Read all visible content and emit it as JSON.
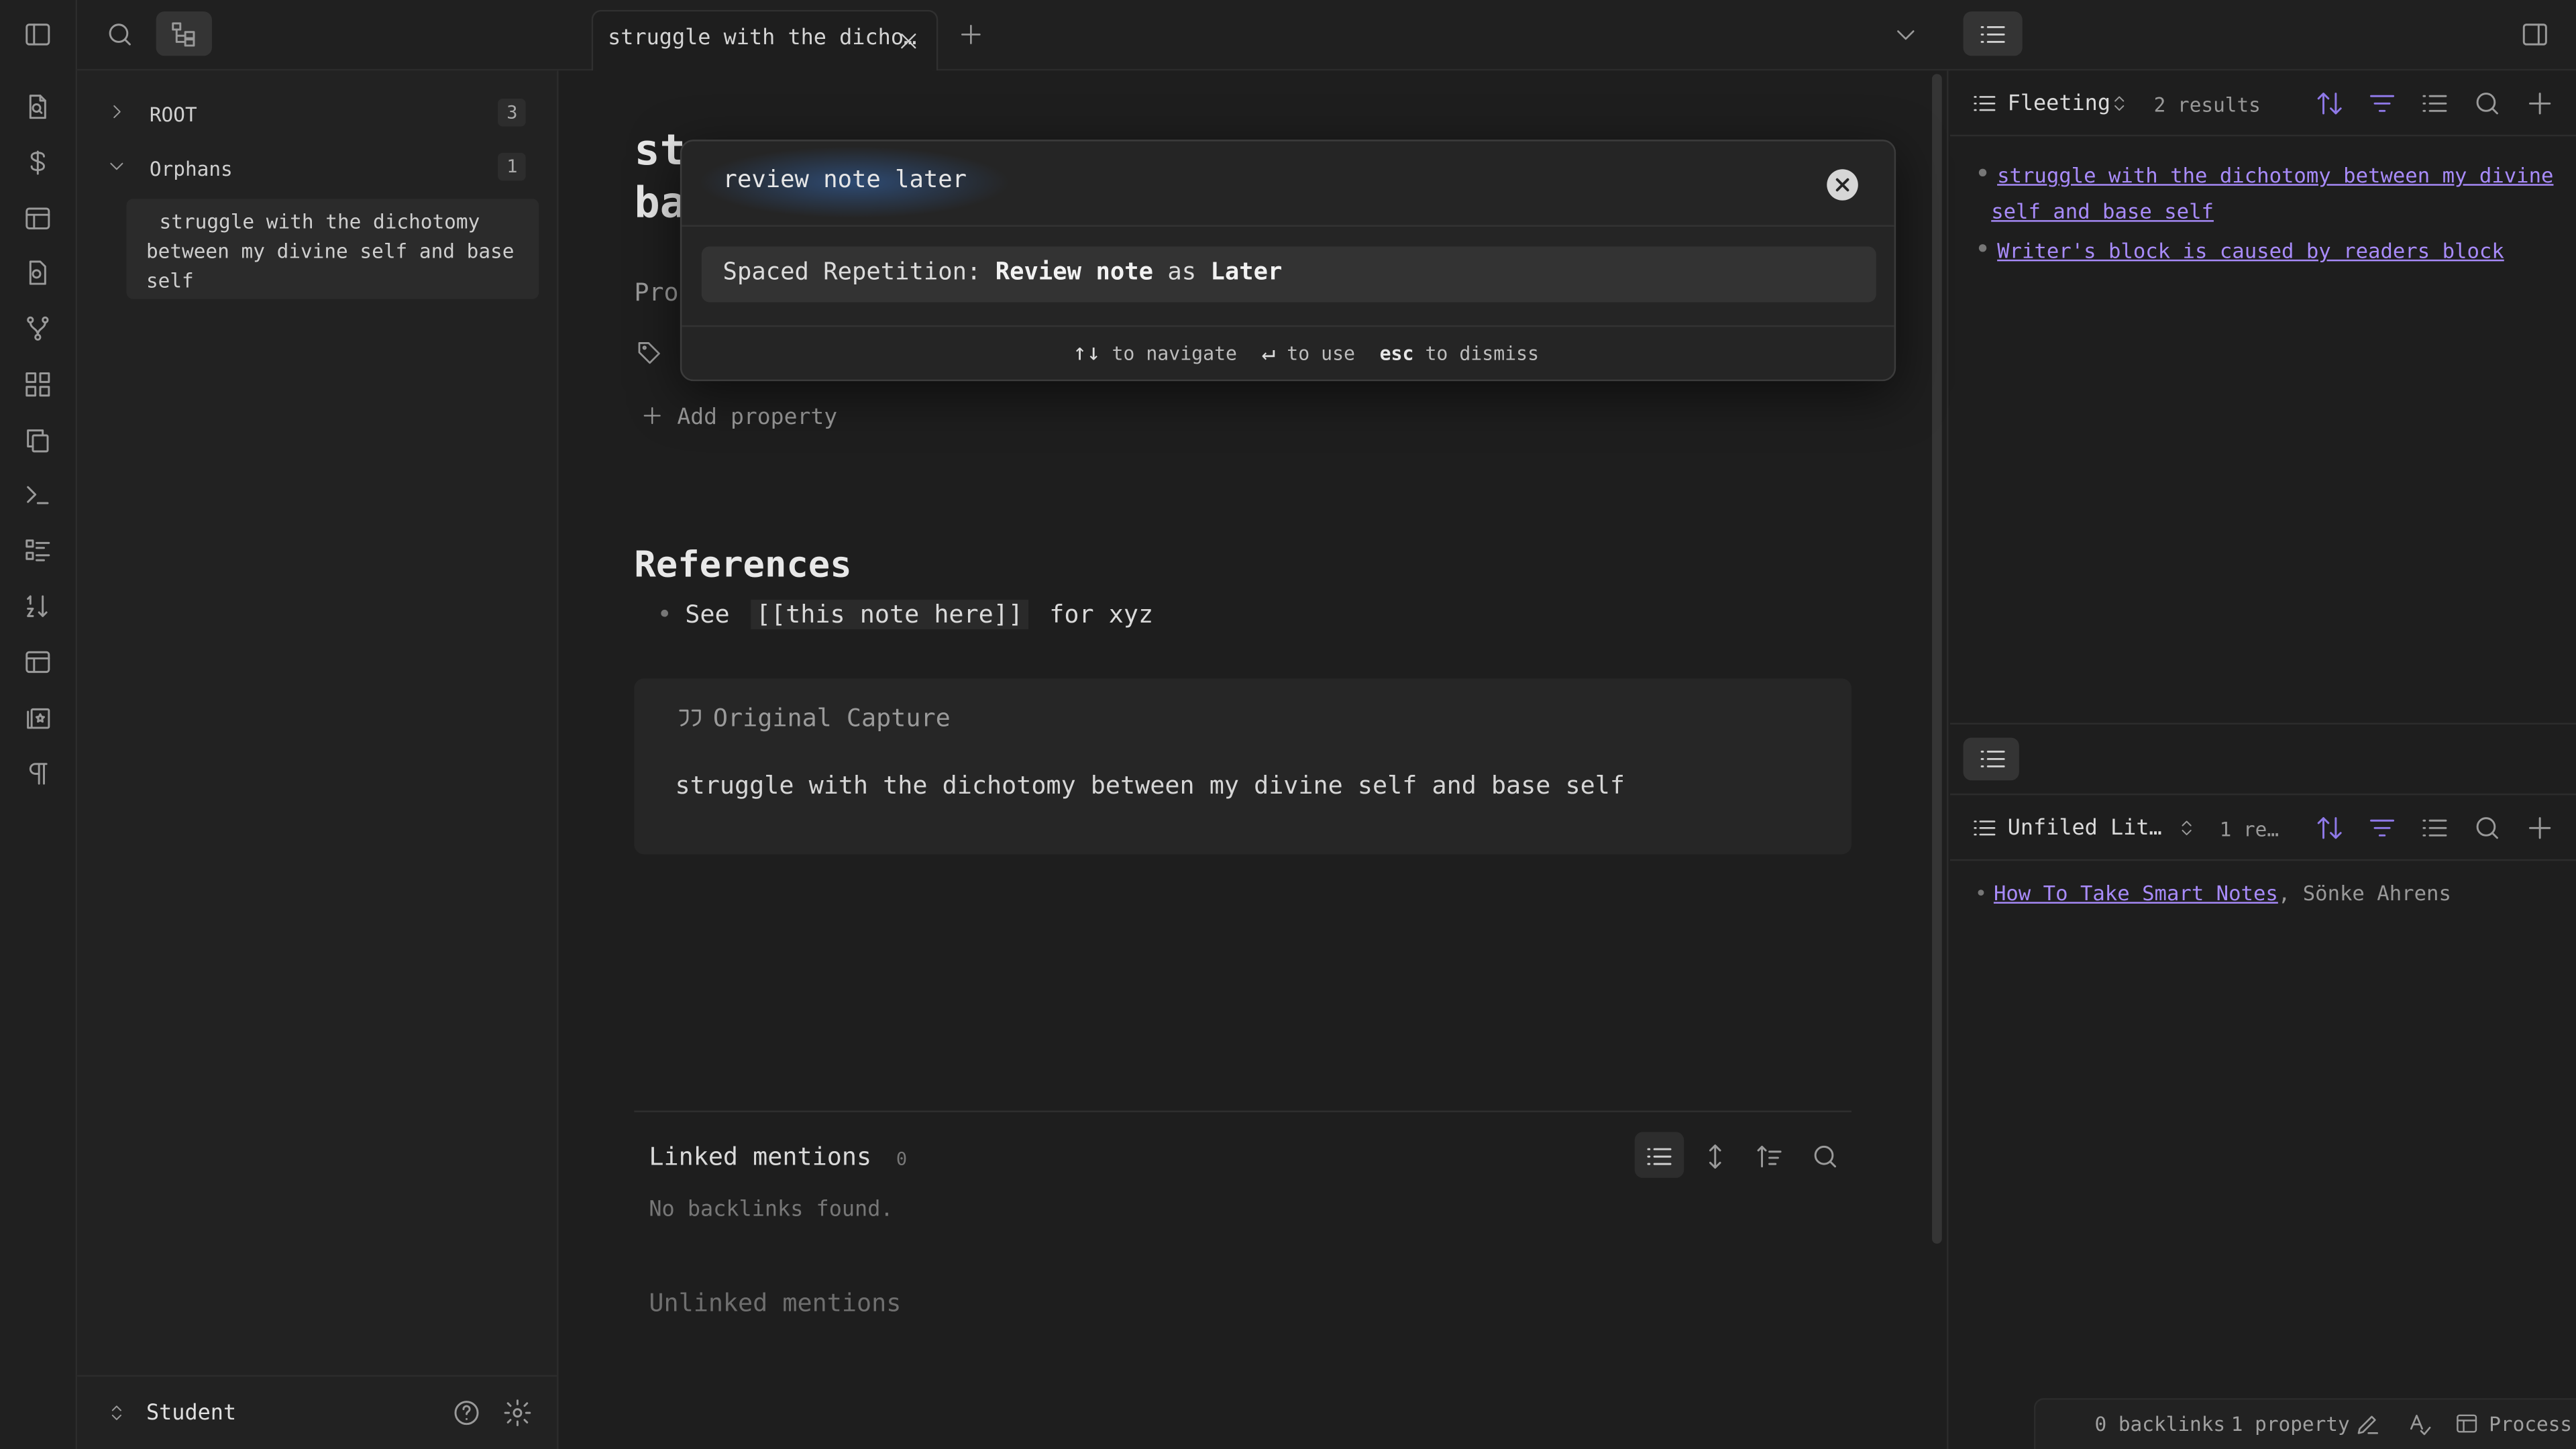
{
  "tab": {
    "title": "struggle with the dicho…"
  },
  "explorer": {
    "root_label": "ROOT",
    "root_count": "3",
    "orphans_label": "Orphans",
    "orphans_count": "1",
    "note_card": "struggle with the dichotomy between my divine self and base self",
    "vault_name": "Student"
  },
  "editor": {
    "title_line1": "st",
    "title_line2": "ba",
    "properties_label": "Pro",
    "add_property": "Add property",
    "references_heading": "References",
    "ref_see": "See",
    "ref_link": "[[this note here]]",
    "ref_rest": "for xyz",
    "callout_title": "Original Capture",
    "callout_body": "struggle with the dichotomy between my divine self and base self",
    "linked_mentions": "Linked mentions",
    "linked_count": "0",
    "no_backlinks": "No backlinks found.",
    "unlinked_mentions": "Unlinked mentions"
  },
  "popup": {
    "query": "review note later",
    "suggestion_prefix": "Spaced Repetition:",
    "suggestion_bold1": "Review note",
    "suggestion_mid": "as",
    "suggestion_bold2": "Later",
    "hint_navigate": "to navigate",
    "hint_use": "to use",
    "hint_esc": "esc",
    "hint_dismiss": "to dismiss"
  },
  "right_top": {
    "query_name": "Fleeting",
    "results": "2 results",
    "items": [
      "struggle with the dichotomy between my divine",
      "self and base self",
      "Writer's block is caused by readers block"
    ]
  },
  "right_bottom": {
    "query_name": "Unfiled Lit…",
    "results": "1 re…",
    "item_link": "How To Take Smart Notes",
    "item_author": ", Sönke Ahrens"
  },
  "status": {
    "backlinks": "0 backlinks",
    "property": "1 property",
    "process": "Process"
  },
  "colors": {
    "accent": "#8f79e8",
    "link": "#a88bfa",
    "bg": "#1e1e1e"
  }
}
